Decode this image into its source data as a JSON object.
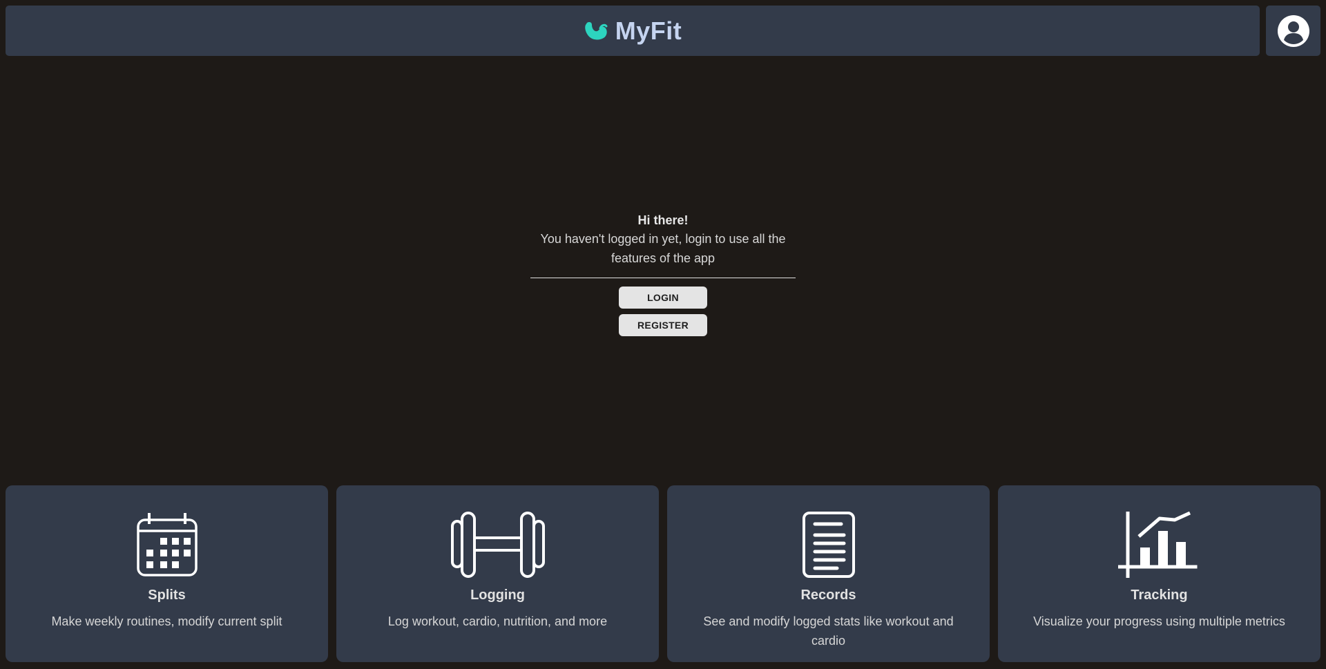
{
  "header": {
    "brand_name": "MyFit",
    "logo_icon": "flexed-arm-icon",
    "accent_color": "#2dd4bf",
    "profile_icon": "user-circle-icon"
  },
  "welcome": {
    "title": "Hi there!",
    "message": "You haven't logged in yet, login to use all the features of the app",
    "login_label": "LOGIN",
    "register_label": "REGISTER"
  },
  "features": [
    {
      "icon": "calendar-icon",
      "title": "Splits",
      "description": "Make weekly routines, modify current split"
    },
    {
      "icon": "dumbbell-icon",
      "title": "Logging",
      "description": "Log workout, cardio, nutrition, and more"
    },
    {
      "icon": "document-icon",
      "title": "Records",
      "description": "See and modify logged stats like workout and cardio"
    },
    {
      "icon": "chart-icon",
      "title": "Tracking",
      "description": "Visualize your progress using multiple metrics"
    }
  ]
}
